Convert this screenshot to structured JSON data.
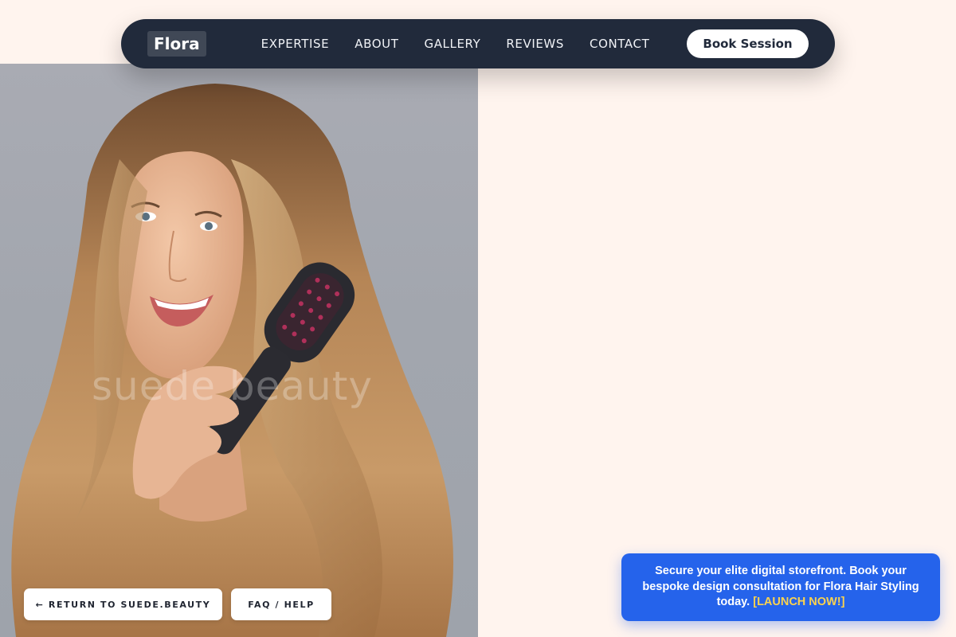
{
  "navbar": {
    "logo": "Flora",
    "links": [
      "EXPERTISE",
      "ABOUT",
      "GALLERY",
      "REVIEWS",
      "CONTACT"
    ],
    "cta_label": "Book Session"
  },
  "hero": {
    "watermark": "suede beauty"
  },
  "footer_buttons": {
    "return_label": "← RETURN TO SUEDE.BEAUTY",
    "faq_label": "FAQ / HELP"
  },
  "promo": {
    "text": "Secure your elite digital storefront. Book your bespoke design consultation for Flora Hair Styling today.",
    "cta": "[LAUNCH NOW!]"
  },
  "colors": {
    "page_bg": "#fff4ee",
    "navbar_bg": "#212a3b",
    "promo_bg": "#2563eb",
    "promo_cta": "#fcd34d"
  }
}
